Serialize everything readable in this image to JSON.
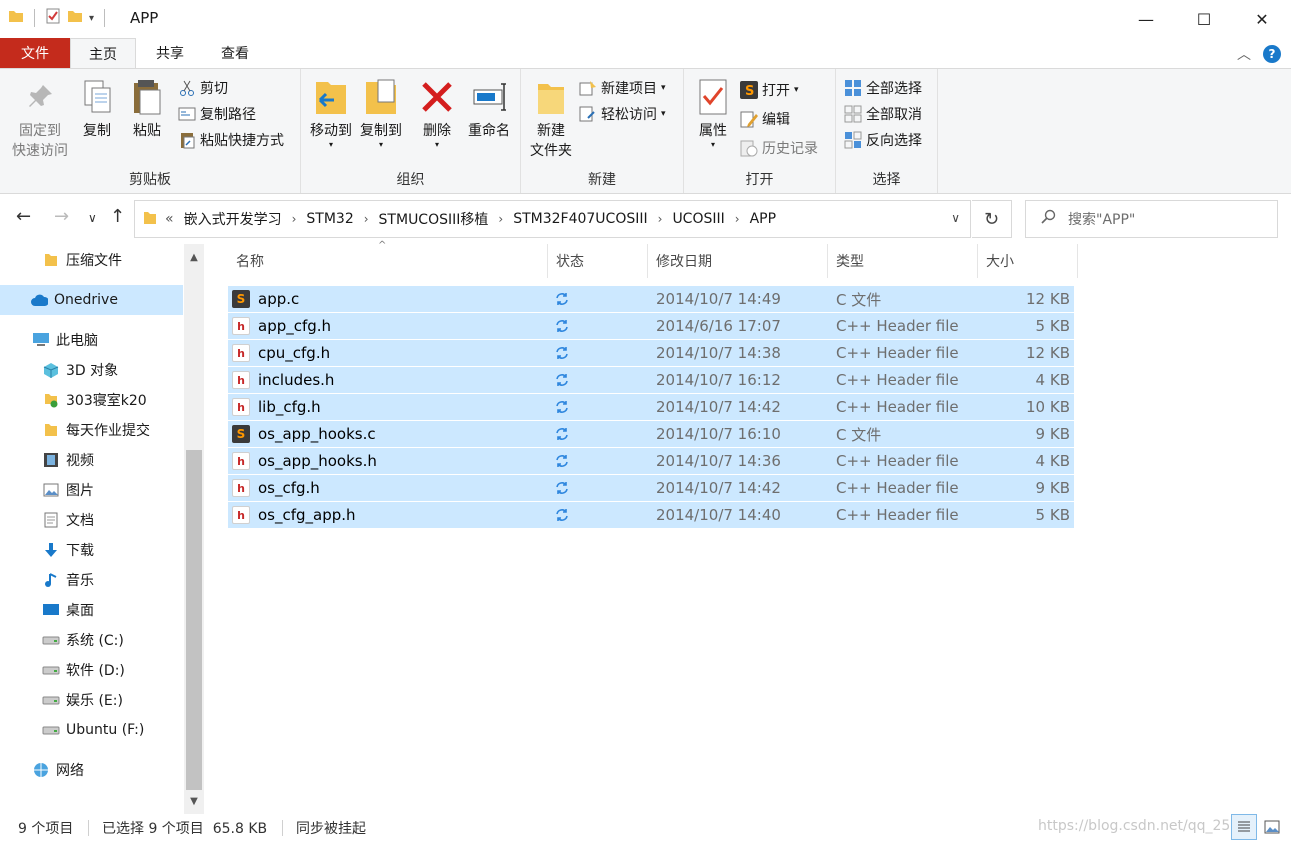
{
  "window": {
    "title": "APP"
  },
  "tabs": {
    "file": "文件",
    "home": "主页",
    "share": "共享",
    "view": "查看"
  },
  "ribbon": {
    "clipboard": {
      "label": "剪贴板",
      "pin_line1": "固定到",
      "pin_line2": "快速访问",
      "copy": "复制",
      "paste": "粘贴",
      "cut": "剪切",
      "copy_path": "复制路径",
      "paste_shortcut": "粘贴快捷方式"
    },
    "organize": {
      "label": "组织",
      "move_to": "移动到",
      "copy_to": "复制到",
      "delete": "删除",
      "rename": "重命名"
    },
    "new": {
      "label": "新建",
      "new_folder_line1": "新建",
      "new_folder_line2": "文件夹",
      "new_item": "新建项目",
      "easy_access": "轻松访问"
    },
    "open": {
      "label": "打开",
      "properties": "属性",
      "open": "打开",
      "edit": "编辑",
      "history": "历史记录"
    },
    "select": {
      "label": "选择",
      "select_all": "全部选择",
      "select_none": "全部取消",
      "invert": "反向选择"
    }
  },
  "breadcrumb": {
    "overflow": "«",
    "parts": [
      "嵌入式开发学习",
      "STM32",
      "STMUCOSIII移植",
      "STM32F407UCOSIII",
      "UCOSIII",
      "APP"
    ]
  },
  "search": {
    "placeholder": "搜索\"APP\""
  },
  "sidebar": {
    "items": [
      {
        "label": "压缩文件",
        "icon": "folder-icon"
      },
      {
        "label": "Onedrive",
        "icon": "cloud-icon"
      },
      {
        "label": "此电脑",
        "icon": "computer-icon"
      },
      {
        "label": "3D 对象",
        "icon": "cube-icon"
      },
      {
        "label": "303寝室k20",
        "icon": "network-folder-icon"
      },
      {
        "label": "每天作业提交",
        "icon": "folder-icon"
      },
      {
        "label": "视频",
        "icon": "film-icon"
      },
      {
        "label": "图片",
        "icon": "picture-icon"
      },
      {
        "label": "文档",
        "icon": "document-icon"
      },
      {
        "label": "下载",
        "icon": "download-icon"
      },
      {
        "label": "音乐",
        "icon": "music-icon"
      },
      {
        "label": "桌面",
        "icon": "desktop-icon"
      },
      {
        "label": "系统 (C:)",
        "icon": "drive-icon"
      },
      {
        "label": "软件 (D:)",
        "icon": "drive-icon"
      },
      {
        "label": "娱乐 (E:)",
        "icon": "drive-icon"
      },
      {
        "label": "Ubuntu (F:)",
        "icon": "drive-icon"
      },
      {
        "label": "网络",
        "icon": "network-icon"
      }
    ]
  },
  "columns": {
    "name": "名称",
    "status": "状态",
    "modified": "修改日期",
    "type": "类型",
    "size": "大小"
  },
  "files": [
    {
      "name": "app.c",
      "date": "2014/10/7 14:49",
      "type": "C 文件",
      "size": "12 KB",
      "kind": "c"
    },
    {
      "name": "app_cfg.h",
      "date": "2014/6/16 17:07",
      "type": "C++ Header file",
      "size": "5 KB",
      "kind": "h"
    },
    {
      "name": "cpu_cfg.h",
      "date": "2014/10/7 14:38",
      "type": "C++ Header file",
      "size": "12 KB",
      "kind": "h"
    },
    {
      "name": "includes.h",
      "date": "2014/10/7 16:12",
      "type": "C++ Header file",
      "size": "4 KB",
      "kind": "h"
    },
    {
      "name": "lib_cfg.h",
      "date": "2014/10/7 14:42",
      "type": "C++ Header file",
      "size": "10 KB",
      "kind": "h"
    },
    {
      "name": "os_app_hooks.c",
      "date": "2014/10/7 16:10",
      "type": "C 文件",
      "size": "9 KB",
      "kind": "c"
    },
    {
      "name": "os_app_hooks.h",
      "date": "2014/10/7 14:36",
      "type": "C++ Header file",
      "size": "4 KB",
      "kind": "h"
    },
    {
      "name": "os_cfg.h",
      "date": "2014/10/7 14:42",
      "type": "C++ Header file",
      "size": "9 KB",
      "kind": "h"
    },
    {
      "name": "os_cfg_app.h",
      "date": "2014/10/7 14:40",
      "type": "C++ Header file",
      "size": "5 KB",
      "kind": "h"
    }
  ],
  "statusbar": {
    "count": "9 个项目",
    "selected": "已选择 9 个项目  65.8 KB",
    "sync": "同步被挂起",
    "watermark": "https://blog.csdn.net/qq_25..."
  },
  "colors": {
    "selection": "#cce8ff",
    "file_tab": "#c42b1c",
    "accent": "#1979ca"
  }
}
